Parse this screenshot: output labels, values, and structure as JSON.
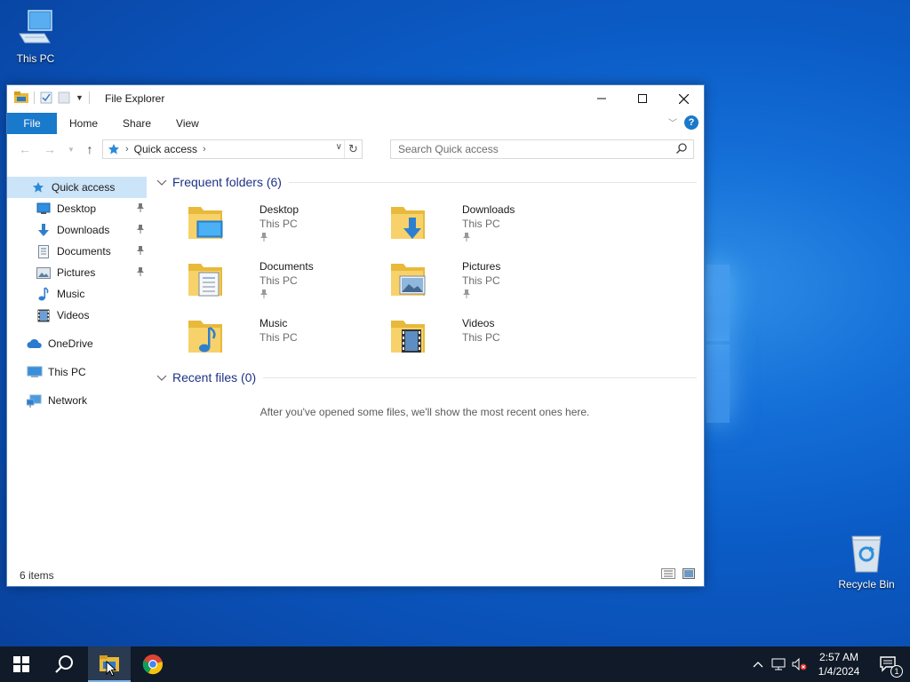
{
  "desktop": {
    "icons": [
      {
        "label": "This PC",
        "icon": "this-pc-icon"
      },
      {
        "label": "Recycle Bin",
        "icon": "recycle-bin-icon"
      }
    ]
  },
  "window": {
    "title": "File Explorer",
    "ribbon_tabs": [
      "File",
      "Home",
      "Share",
      "View"
    ],
    "help_label": "?",
    "address": {
      "crumb": "Quick access"
    },
    "search": {
      "placeholder": "Search Quick access"
    }
  },
  "sidebar": {
    "items": [
      {
        "label": "Quick access",
        "icon": "star-icon",
        "selected": true
      },
      {
        "label": "Desktop",
        "icon": "desktop-icon",
        "pinned": true
      },
      {
        "label": "Downloads",
        "icon": "download-arrow-icon",
        "pinned": true
      },
      {
        "label": "Documents",
        "icon": "document-icon",
        "pinned": true
      },
      {
        "label": "Pictures",
        "icon": "picture-icon",
        "pinned": true
      },
      {
        "label": "Music",
        "icon": "music-note-icon"
      },
      {
        "label": "Videos",
        "icon": "film-icon"
      },
      {
        "label": "OneDrive",
        "icon": "cloud-icon"
      },
      {
        "label": "This PC",
        "icon": "computer-icon"
      },
      {
        "label": "Network",
        "icon": "network-icon"
      }
    ]
  },
  "content": {
    "frequent_header": "Frequent folders (6)",
    "folders": [
      {
        "name": "Desktop",
        "location": "This PC",
        "pinned": true
      },
      {
        "name": "Downloads",
        "location": "This PC",
        "pinned": true
      },
      {
        "name": "Documents",
        "location": "This PC",
        "pinned": true
      },
      {
        "name": "Pictures",
        "location": "This PC",
        "pinned": true
      },
      {
        "name": "Music",
        "location": "This PC",
        "pinned": false
      },
      {
        "name": "Videos",
        "location": "This PC",
        "pinned": false
      }
    ],
    "recent_header": "Recent files (0)",
    "recent_empty": "After you've opened some files, we'll show the most recent ones here."
  },
  "status": {
    "item_count": "6 items"
  },
  "taskbar": {
    "clock_time": "2:57 AM",
    "clock_date": "1/4/2024",
    "notification_count": "1"
  },
  "colors": {
    "accent": "#1979ca",
    "selection": "#cce4f7",
    "header_text": "#1e3287"
  }
}
